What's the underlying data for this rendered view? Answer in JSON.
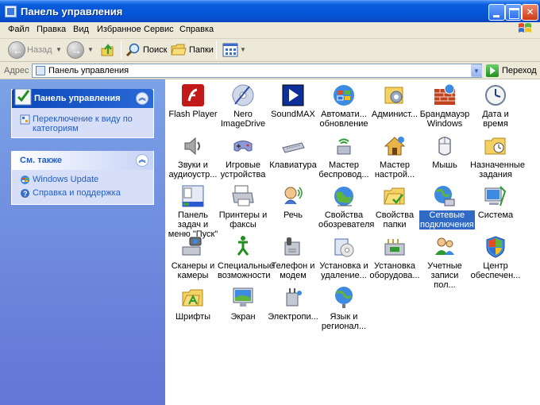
{
  "window": {
    "title": "Панель управления"
  },
  "menu": [
    "Файл",
    "Правка",
    "Вид",
    "Избранное",
    "Сервис",
    "Справка"
  ],
  "toolbar": {
    "back": "Назад",
    "search": "Поиск",
    "folders": "Папки"
  },
  "address": {
    "label": "Адрес",
    "value": "Панель управления",
    "go": "Переход"
  },
  "left_panel": {
    "control_panel": {
      "title": "Панель управления",
      "link": "Переключение к виду по категориям"
    },
    "see_also": {
      "title": "См. также",
      "links": [
        "Windows Update",
        "Справка и поддержка"
      ]
    }
  },
  "items": [
    {
      "label": "Flash Player",
      "icon": "flash-player-icon"
    },
    {
      "label": "Nero ImageDrive",
      "icon": "nero-icon"
    },
    {
      "label": "SoundMAX",
      "icon": "soundmax-icon"
    },
    {
      "label": "Автомати... обновление",
      "icon": "automatic-updates-icon"
    },
    {
      "label": "Админист...",
      "icon": "admin-tools-icon"
    },
    {
      "label": "Брандмауэр Windows",
      "icon": "firewall-icon"
    },
    {
      "label": "Дата и время",
      "icon": "clock-icon"
    },
    {
      "label": "Звуки и аудиоустр...",
      "icon": "speaker-icon"
    },
    {
      "label": "Игровые устройства",
      "icon": "gamepad-icon"
    },
    {
      "label": "Клавиатура",
      "icon": "keyboard-icon"
    },
    {
      "label": "Мастер беспровод...",
      "icon": "wireless-icon"
    },
    {
      "label": "Мастер настрой...",
      "icon": "network-setup-icon"
    },
    {
      "label": "Мышь",
      "icon": "mouse-icon"
    },
    {
      "label": "Назначенные задания",
      "icon": "scheduled-tasks-icon"
    },
    {
      "label": "Панель задач и меню \"Пуск\"",
      "icon": "taskbar-icon"
    },
    {
      "label": "Принтеры и факсы",
      "icon": "printer-icon"
    },
    {
      "label": "Речь",
      "icon": "speech-icon"
    },
    {
      "label": "Свойства обозревателя",
      "icon": "internet-options-icon"
    },
    {
      "label": "Свойства папки",
      "icon": "folder-options-icon"
    },
    {
      "label": "Сетевые подключения",
      "icon": "network-connections-icon",
      "selected": true
    },
    {
      "label": "Система",
      "icon": "system-icon"
    },
    {
      "label": "Сканеры и камеры",
      "icon": "scanner-icon"
    },
    {
      "label": "Специальные возможности",
      "icon": "accessibility-icon"
    },
    {
      "label": "Телефон и модем",
      "icon": "phone-icon"
    },
    {
      "label": "Установка и удаление...",
      "icon": "add-remove-icon"
    },
    {
      "label": "Установка оборудова...",
      "icon": "hardware-icon"
    },
    {
      "label": "Учетные записи пол...",
      "icon": "user-accounts-icon"
    },
    {
      "label": "Центр обеспечен...",
      "icon": "security-center-icon"
    },
    {
      "label": "Шрифты",
      "icon": "fonts-icon"
    },
    {
      "label": "Экран",
      "icon": "display-icon"
    },
    {
      "label": "Электропи...",
      "icon": "power-icon"
    },
    {
      "label": "Язык и регионал...",
      "icon": "regional-icon"
    }
  ]
}
